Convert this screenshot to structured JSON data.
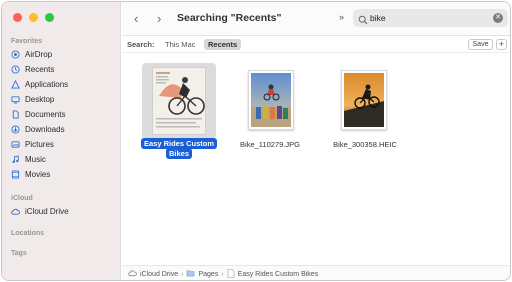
{
  "sidebar": {
    "favorites_label": "Favorites",
    "items": [
      {
        "label": "AirDrop",
        "icon": "airdrop-icon"
      },
      {
        "label": "Recents",
        "icon": "recents-clock-icon"
      },
      {
        "label": "Applications",
        "icon": "applications-icon"
      },
      {
        "label": "Desktop",
        "icon": "desktop-icon"
      },
      {
        "label": "Documents",
        "icon": "documents-icon"
      },
      {
        "label": "Downloads",
        "icon": "downloads-icon"
      },
      {
        "label": "Pictures",
        "icon": "pictures-icon"
      },
      {
        "label": "Music",
        "icon": "music-icon"
      },
      {
        "label": "Movies",
        "icon": "movies-icon"
      }
    ],
    "icloud_label": "iCloud",
    "icloud_items": [
      {
        "label": "iCloud Drive",
        "icon": "icloud-icon"
      }
    ],
    "locations_label": "Locations",
    "tags_label": "Tags"
  },
  "toolbar": {
    "back": "‹",
    "forward": "›",
    "title": "Searching \"Recents\"",
    "more": "»",
    "search_value": "bike"
  },
  "scope": {
    "label": "Search:",
    "this_mac": "This Mac",
    "recents": "Recents",
    "save": "Save",
    "add": "+"
  },
  "files": [
    {
      "name_line1": "Easy Rides Custom",
      "name_line2": "Bikes",
      "selected": true
    },
    {
      "name": "Bike_110279.JPG",
      "selected": false
    },
    {
      "name": "Bike_300358.HEIC",
      "selected": false
    }
  ],
  "pathbar": {
    "seg1": "iCloud Drive",
    "seg2": "Pages",
    "seg3": "Easy Rides Custom Bikes"
  },
  "colors": {
    "accent": "#1a5fd4",
    "sidebar_bg": "#f1eaea",
    "sidebar_icon": "#2f6fd8"
  }
}
